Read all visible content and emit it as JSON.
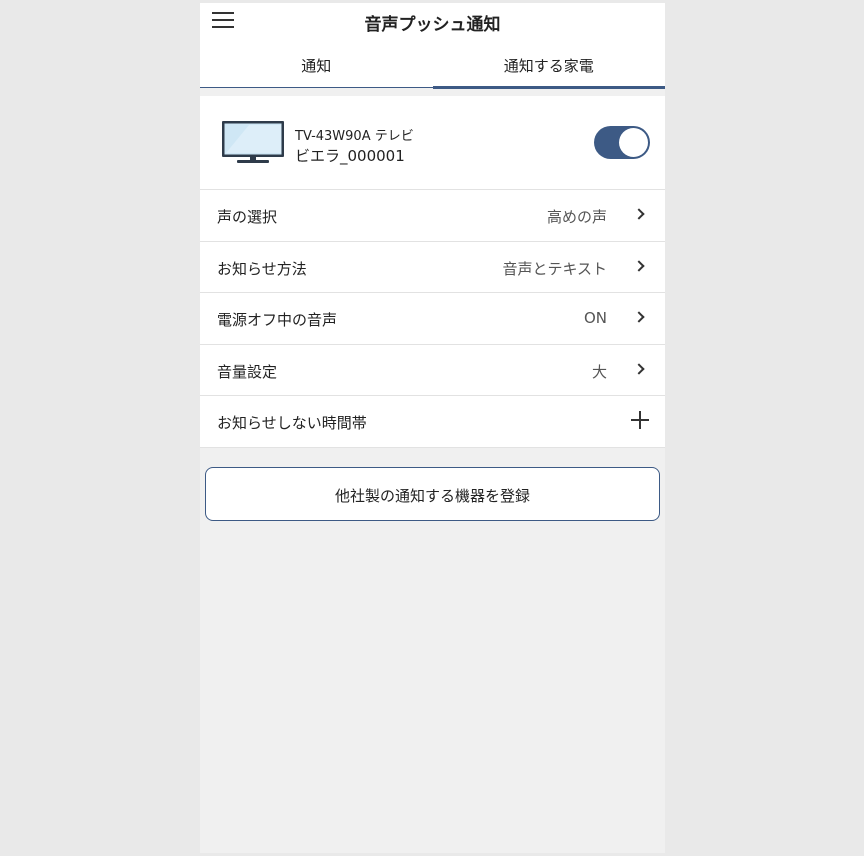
{
  "header": {
    "title": "音声プッシュ通知",
    "menu_icon": "hamburger-menu-icon"
  },
  "tabs": [
    {
      "label": "通知",
      "active": false
    },
    {
      "label": "通知する家電",
      "active": true
    }
  ],
  "device": {
    "icon": "tv-icon",
    "model": "TV-43W90A テレビ",
    "name": "ビエラ_000001",
    "enabled": true
  },
  "settings": [
    {
      "label": "声の選択",
      "value": "高めの声",
      "action_icon": "chevron-right-icon"
    },
    {
      "label": "お知らせ方法",
      "value": "音声とテキスト",
      "action_icon": "chevron-right-icon"
    },
    {
      "label": "電源オフ中の音声",
      "value": "ON",
      "action_icon": "chevron-right-icon"
    },
    {
      "label": "音量設定",
      "value": "大",
      "action_icon": "chevron-right-icon"
    },
    {
      "label": "お知らせしない時間帯",
      "value": "",
      "action_icon": "plus-icon"
    }
  ],
  "register_button": "他社製の通知する機器を登録",
  "colors": {
    "accent": "#3d5a85",
    "background": "#f0f0f0",
    "surface": "#ffffff",
    "outer_background": "#e9e9e9"
  }
}
